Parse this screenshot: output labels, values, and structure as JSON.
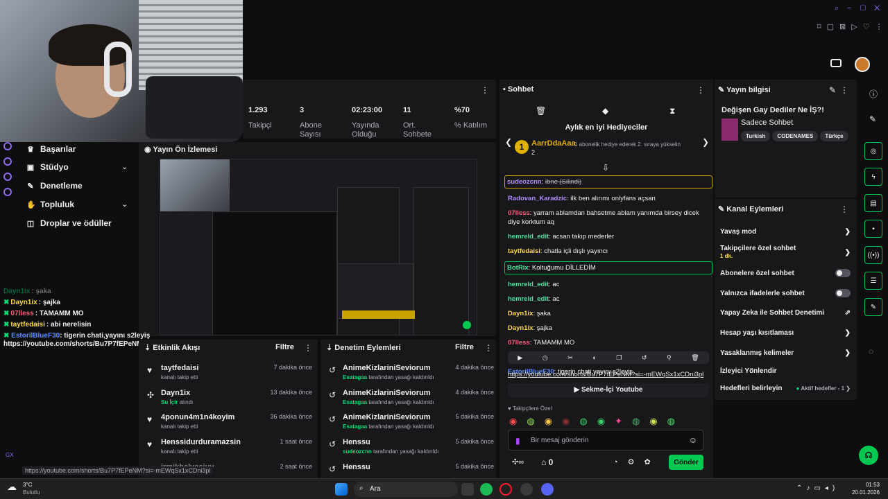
{
  "stats": [
    {
      "value": "1.293",
      "label": "Takipçi"
    },
    {
      "value": "3",
      "label": "Abone Sayısı"
    },
    {
      "value": "02:23:00",
      "label": "Yayında Olduğu"
    },
    {
      "value": "11",
      "label": "Ort. Sohbete"
    },
    {
      "value": "%70",
      "label": "% Katılım"
    }
  ],
  "nav": {
    "items": [
      {
        "label": "Başarılar"
      },
      {
        "label": "Stüdyo"
      },
      {
        "label": "Denetleme"
      },
      {
        "label": "Topluluk"
      },
      {
        "label": "Droplar ve ödüller"
      }
    ]
  },
  "preview": {
    "title": "Yayın Ön İzlemesi"
  },
  "overlay_chat": [
    {
      "user": "Dayn1ix",
      "text": ": şaka"
    },
    {
      "user": "Dayn1ix",
      "text": ": şajka"
    },
    {
      "user": "07lless",
      "text": ": TAMAMM MO"
    },
    {
      "user": "taytfedaisi",
      "text": ": abi nerelisin"
    },
    {
      "user": "EstorilBlueF30",
      "text": ": tigerin chati,yayını s2leyiş https://youtube.com/shorts/Bu7P7fEPeNM?si=-mEWqSx1xCDni3pl"
    }
  ],
  "activity": {
    "title": "Etkinlik Akışı",
    "filter": "Filtre",
    "rows": [
      {
        "name": "taytfedaisi",
        "desc": "kanalı takip etti",
        "time": "7 dakika önce"
      },
      {
        "name": "Dayn1ix",
        "desc_hl": "Su İçir",
        "desc": "alındı",
        "time": "13 dakika önce"
      },
      {
        "name": "4ponun4m1n4koyim",
        "desc": "kanalı takip etti",
        "time": "36 dakika önce"
      },
      {
        "name": "Henssidurduramazsin",
        "desc": "kanalı takip etti",
        "time": "1 saat önce"
      },
      {
        "name": "irmikhelvasiuy",
        "desc": "",
        "time": "2 saat önce"
      }
    ]
  },
  "moderation": {
    "title": "Denetim Eylemleri",
    "filter": "Filtre",
    "rows": [
      {
        "name": "AnimeKizlariniSeviorum",
        "by": "Esatagaa",
        "desc": "tarafından yasağı kaldırıldı",
        "time": "4 dakika önce"
      },
      {
        "name": "AnimeKizlariniSeviorum",
        "by": "Esatagaa",
        "desc": "tarafından yasağı kaldırıldı",
        "time": "4 dakika önce"
      },
      {
        "name": "AnimeKizlariniSeviorum",
        "by": "Esatagaa",
        "desc": "tarafından yasağı kaldırıldı",
        "time": "5 dakika önce"
      },
      {
        "name": "Henssu",
        "by": "sudeozcnn",
        "desc": "tarafından yasağı kaldırıldı",
        "time": "5 dakika önce"
      },
      {
        "name": "Henssu",
        "by": "",
        "desc": "",
        "time": "5 dakika önce"
      }
    ]
  },
  "chat": {
    "title": "Sohbet",
    "gifters_title": "Aylık en iyi Hediyeciler",
    "top_gifter": "AarrDdaAaa",
    "top_gifter_count": "2",
    "gifter_note": "1 abonelik hediye ederek 2. sıraya yükselin",
    "messages": [
      {
        "user": "sudeozcnn",
        "text": "ibne (Silindi)",
        "color": "#b48cff",
        "hl": "y"
      },
      {
        "user": "Radovan_Karadzic",
        "text": "ilk ben alırımı onlyfans açsan",
        "color": "#b48cff"
      },
      {
        "user": "07lless",
        "text": "yarram ablamdan bahsetme ablam yanımda birsey dicek diye korktum aq",
        "color": "#ff5a7a"
      },
      {
        "user": "hemreld_edit",
        "text": "acsan takıp mederler",
        "color": "#4fe0a0"
      },
      {
        "user": "taytfedaisi",
        "text": "chatla içli dışlı yayıncı",
        "color": "#ffd84a"
      },
      {
        "user": "BotRix",
        "text": "Koltuğumu DİLLEDİM",
        "color": "#4fe0a0",
        "hl": "g"
      },
      {
        "user": "hemreld_edit",
        "text": "ac",
        "color": "#4fe0a0"
      },
      {
        "user": "hemreld_edit",
        "text": "ac",
        "color": "#4fe0a0"
      },
      {
        "user": "Dayn1ix",
        "text": "şaka",
        "color": "#ffd84a"
      },
      {
        "user": "Dayn1ix",
        "text": "şajka",
        "color": "#ffd84a"
      },
      {
        "user": "07lless",
        "text": "TAMAMM MO",
        "color": "#ff5a7a"
      },
      {
        "user": "taytfedaisi",
        "text": "abi nerelisin",
        "color": "#ffd84a"
      },
      {
        "user": "EstorilBlueF30",
        "text": "tigerin chati,yayını s2leyiş",
        "color": "#5b8cff"
      }
    ],
    "link": "https://youtube.com/shorts/Bu7P7fEPeNM?si=-mEWqSx1xCDni3pl",
    "embed_label": "Sekme-İçi Youtube",
    "emote_label": "Takipçilere Özel",
    "input_placeholder": "Bir mesaj gönderin",
    "points": "0",
    "send_label": "Gönder"
  },
  "stream_info": {
    "title": "Yayın bilgisi",
    "stream_title": "Değişen Gay Dediler Ne İŞ?!",
    "category": "Sadece Sohbet",
    "tags": [
      "Turkish",
      "CODENAMES",
      "Türkçe"
    ]
  },
  "channel_actions": {
    "title": "Kanal Eylemleri",
    "items": [
      {
        "label": "Yavaş mod",
        "type": "chevron"
      },
      {
        "label": "Takipçilere özel sohbet",
        "sub": "1 dk.",
        "type": "chevron"
      },
      {
        "label": "Abonelere özel sohbet",
        "type": "toggle"
      },
      {
        "label": "Yalnızca ifadelerle sohbet",
        "type": "toggle"
      },
      {
        "label": "Yapay Zeka ile Sohbet Denetimi",
        "type": "ext"
      },
      {
        "label": "Hesap yaşı kısıtlaması",
        "type": "chevron"
      },
      {
        "label": "Yasaklanmış kelimeler",
        "type": "chevron"
      },
      {
        "label": "İzleyici Yönlendir",
        "type": "none"
      },
      {
        "label": "Hedefleri belirleyin",
        "sub": "Aktif hedefler - 1",
        "type": "chevron"
      }
    ]
  },
  "taskbar": {
    "weather_temp": "3°C",
    "weather_desc": "Bulutlu",
    "search_placeholder": "Ara",
    "time": "01:53",
    "date": "20.01.2026"
  },
  "status_url": "https://youtube.com/shorts/Bu7P7fEPeNM?si=-mEWqSx1xCDni3pl",
  "colors": {
    "accent": "#00c850",
    "purple": "#8f6af5",
    "bg": "#0e0e10",
    "panel": "#18181b"
  }
}
